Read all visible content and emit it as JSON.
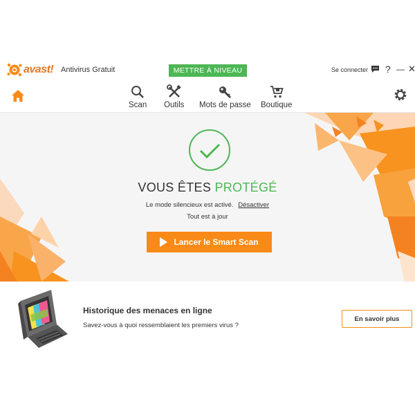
{
  "titlebar": {
    "brand": "avast!",
    "product": "Antivirus Gratuit",
    "upgrade_label": "METTRE À NIVEAU",
    "signin_label": "Se connecter",
    "help_label": "?",
    "minimize_label": "—",
    "close_label": "✕"
  },
  "nav": {
    "items": [
      {
        "label": "Scan",
        "icon": "magnifier-icon"
      },
      {
        "label": "Outils",
        "icon": "tools-icon"
      },
      {
        "label": "Mots de passe",
        "icon": "key-icon"
      },
      {
        "label": "Boutique",
        "icon": "cart-icon"
      }
    ]
  },
  "hero": {
    "status_prefix": "VOUS ÊTES",
    "status_highlight": "PROTÉGÉ",
    "silent_mode_text": "Le mode silencieux est activé.",
    "silent_mode_link": "Désactiver",
    "uptodate_text": "Tout est à jour",
    "scan_button_label": "Lancer le Smart Scan"
  },
  "promo": {
    "title": "Historique des menaces en ligne",
    "text": "Savez-vous à quoi ressemblaient les premiers virus ?",
    "button_label": "En savoir plus"
  },
  "colors": {
    "brand_orange": "#f98a18",
    "green": "#4cb753",
    "text": "#333333",
    "hero_bg": "#f5f5f5"
  }
}
